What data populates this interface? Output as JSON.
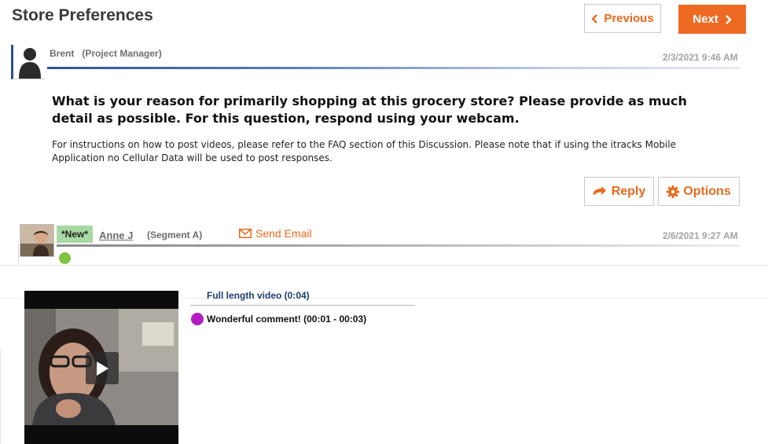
{
  "page_title": "Store Preferences",
  "nav": {
    "previous_label": "Previous",
    "next_label": "Next"
  },
  "post": {
    "author": "Brent",
    "role": "(Project Manager)",
    "timestamp": "2/3/2021 9:46 AM",
    "question": "What is your reason for primarily shopping at this grocery store? Please provide as much detail as possible. For this question, respond using your webcam.",
    "instructions": "For instructions on how to post videos, please refer to the FAQ section of this Discussion. Please note that if using the itracks Mobile Application no Cellular Data will be used to post responses.",
    "reply_label": "Reply",
    "options_label": "Options"
  },
  "response": {
    "badge": "*New*",
    "author": "Anne J",
    "segment": "(Segment A)",
    "send_email_label": "Send Email",
    "timestamp": "2/6/2021 9:27 AM",
    "full_video_label": "Full length video (0:04)",
    "comment_label": "Wonderful comment! (00:01 - 00:03)"
  },
  "colors": {
    "accent": "#ee6a23",
    "link": "#1c3f6e",
    "new_badge": "#a8d8a3",
    "online": "#80c342",
    "comment_marker": "#b41cc2"
  },
  "icons": [
    "chevron-left-icon",
    "chevron-right-icon",
    "reply-arrow-icon",
    "gear-icon",
    "envelope-icon",
    "play-icon",
    "user-silhouette-icon"
  ]
}
